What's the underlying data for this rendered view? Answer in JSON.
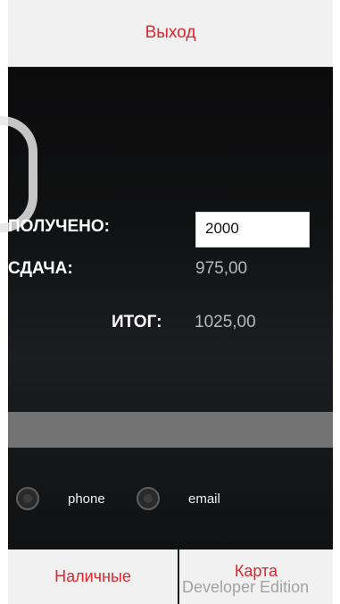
{
  "header": {
    "exit_label": "Выход"
  },
  "payment": {
    "received_label": "ПОЛУЧЕНО:",
    "received_value": "2000",
    "change_label": "СДАЧА:",
    "change_value": "975,00",
    "total_label": "ИТОГ:",
    "total_value": "1025,00"
  },
  "receipt": {
    "options": [
      {
        "label": "phone",
        "selected": false
      },
      {
        "label": "email",
        "selected": false
      }
    ]
  },
  "footer": {
    "cash_label": "Наличные",
    "card_label": "Карта",
    "watermark": "Developer Edition"
  },
  "colors": {
    "accent": "#e0262c",
    "button_bg": "#f1f1f1",
    "bar": "#737373"
  }
}
